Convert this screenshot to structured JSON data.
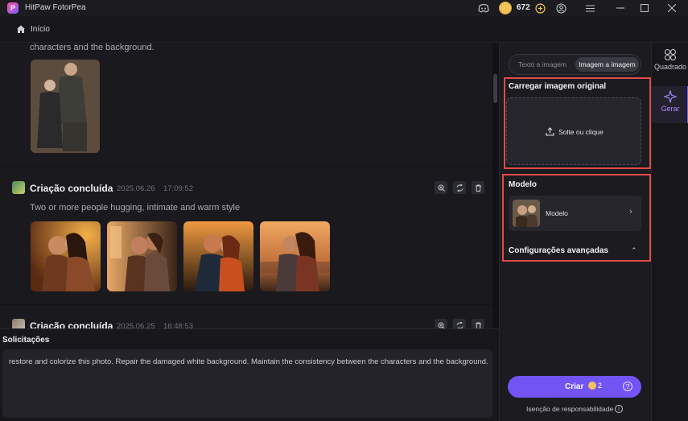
{
  "window": {
    "title": "HitPaw FotorPea",
    "credits": "672",
    "icons": [
      "discord-icon",
      "coin-icon",
      "add-credits-icon",
      "account-icon",
      "menu-icon",
      "minimize-icon",
      "maximize-icon",
      "close-icon"
    ]
  },
  "breadcrumb": {
    "home_label": "Início"
  },
  "feed": {
    "top_partial_prompt": "characters and the background.",
    "cards": [
      {
        "title": "Criação concluída",
        "date": "2025.06.26",
        "time": "17:09:52",
        "prompt": "Two or more people hugging, intimate and warm style"
      },
      {
        "title": "Criação concluída",
        "date": "2025.06.25",
        "time": "16:48:53"
      }
    ]
  },
  "requests": {
    "label": "Solicitações",
    "text": "restore and colorize this photo. Repair the damaged white background. Maintain the consistency between the characters and the background."
  },
  "panel": {
    "tabs": [
      {
        "label": "Texto a imagem",
        "active": false
      },
      {
        "label": "Imagem a imagem",
        "active": true
      }
    ],
    "upload_title": "Carregar imagem original",
    "upload_prompt": "Solte ou clique",
    "model_title": "Modelo",
    "model_name": "Modelo",
    "advanced_label": "Configurações avançadas",
    "create_label": "Criar",
    "create_cost": "2",
    "disclaimer": "Isenção de responsabilidade"
  },
  "nav": {
    "items": [
      {
        "label": "Quadrado",
        "active": false
      },
      {
        "label": "Gerar",
        "active": true
      }
    ]
  },
  "colors": {
    "accent": "#7254f5",
    "highlight": "#e04a48",
    "background": "#121216"
  }
}
